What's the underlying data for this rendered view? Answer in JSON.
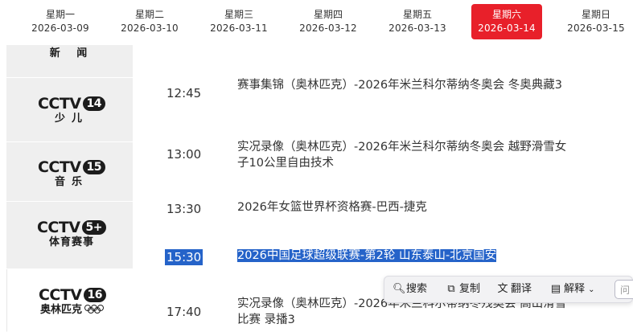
{
  "days": [
    {
      "dow": "星期一",
      "date": "2026-03-09",
      "active": false
    },
    {
      "dow": "星期二",
      "date": "2026-03-10",
      "active": false
    },
    {
      "dow": "星期三",
      "date": "2026-03-11",
      "active": false
    },
    {
      "dow": "星期四",
      "date": "2026-03-12",
      "active": false
    },
    {
      "dow": "星期五",
      "date": "2026-03-13",
      "active": false
    },
    {
      "dow": "星期六",
      "date": "2026-03-14",
      "active": true
    },
    {
      "dow": "星期日",
      "date": "2026-03-15",
      "active": false
    }
  ],
  "channels": [
    {
      "mark": "",
      "num": "",
      "sub": "新 闻"
    },
    {
      "mark": "CCTV",
      "num": "14",
      "sub": "少儿"
    },
    {
      "mark": "CCTV",
      "num": "15",
      "sub": "音乐"
    },
    {
      "mark": "CCTV",
      "num": "5+",
      "sub": "体育赛事"
    },
    {
      "mark": "CCTV",
      "num": "16",
      "sub": "奥林匹克"
    }
  ],
  "programs": [
    {
      "time": "12:45",
      "title": "赛事集锦（奥林匹克）-2026年米兰科尔蒂纳冬奥会 冬奥典藏3"
    },
    {
      "time": "13:00",
      "title": "实况录像（奥林匹克）-2026年米兰科尔蒂纳冬奥会 越野滑雪女子10公里自由技术"
    },
    {
      "time": "13:30",
      "title": "2026年女篮世界杯资格赛-巴西-捷克"
    },
    {
      "time": "15:30",
      "title": "2026中国足球超级联赛-第2轮 山东泰山-北京国安"
    },
    {
      "time": "17:40",
      "title": "实况录像（奥林匹克）-2026年米兰科尔蒂纳冬残奥会 高山滑雪比赛 录播3"
    }
  ],
  "toolbar": {
    "search": "搜索",
    "copy": "复制",
    "translate": "翻译",
    "explain": "解释",
    "ask_placeholder": "问"
  }
}
